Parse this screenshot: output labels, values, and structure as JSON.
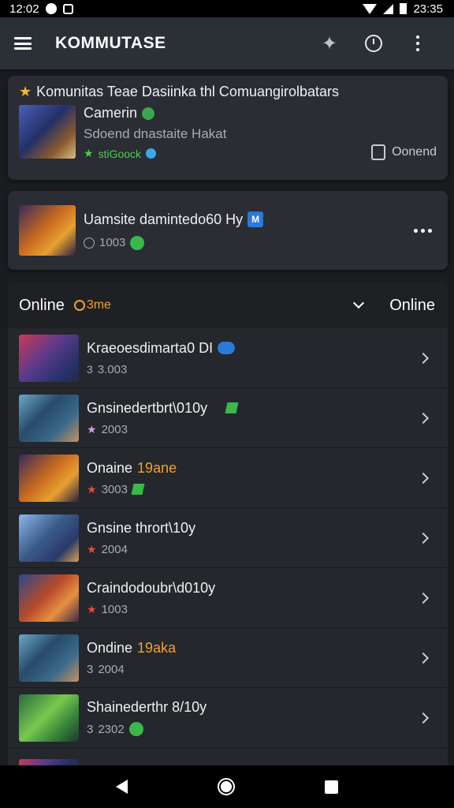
{
  "status_bar": {
    "time_left": "12:02",
    "time_right": "23:35"
  },
  "app_bar": {
    "title": "KOMMUTASE"
  },
  "featured_card": {
    "headline": "Komunitas Teae Dasiinka thl Comuangirolbatars",
    "title": "Camerin",
    "subtitle": "Sdoend dnastaite Hakat",
    "tag": "stiGoock",
    "comment_label": "Oonend"
  },
  "second_card": {
    "title": "Uamsite damintedo60 Hy",
    "badge": "M",
    "meta": "1003"
  },
  "list": {
    "header_title": "Online",
    "header_status": "3me",
    "header_right": "Online",
    "items": [
      {
        "title": "Kraeoesdimarta0 DI",
        "accent": "",
        "meta": "3.003",
        "prefix": "3"
      },
      {
        "title": "Gnsinedertbrt\\010y",
        "accent": "",
        "meta": "2003",
        "prefix": "★"
      },
      {
        "title": "Onaine",
        "accent": "19ane",
        "meta": "3003",
        "prefix": "★"
      },
      {
        "title": "Gnsine thrort\\10y",
        "accent": "",
        "meta": "2004",
        "prefix": "★"
      },
      {
        "title": "Craindodoubr\\d010y",
        "accent": "",
        "meta": "1003",
        "prefix": "★"
      },
      {
        "title": "Ondine",
        "accent": "19aka",
        "meta": "2004",
        "prefix": "3"
      },
      {
        "title": "Shainederthr 8/10y",
        "accent": "",
        "meta": "2302",
        "prefix": "3"
      }
    ]
  },
  "colors": {
    "accent_orange": "#f0a030",
    "accent_green": "#3ab84a",
    "accent_blue": "#2a7ad8",
    "star_gold": "#f5b82e"
  },
  "icons": [
    "menu-icon",
    "sparkle-icon",
    "clock-icon",
    "more-vert-icon",
    "star-icon",
    "comment-icon",
    "chevron-down-icon",
    "chevron-right-icon"
  ]
}
